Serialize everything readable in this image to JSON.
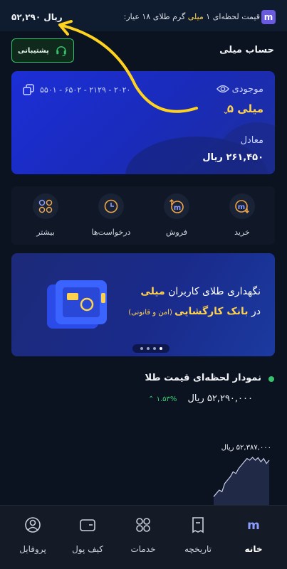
{
  "top_bar": {
    "price": "۵۲,۲۹۰ ریال",
    "ticker_before": "قیمت لحظه‌ای ۱ ",
    "ticker_highlight": "میلی",
    "ticker_after": " گرم طلای ۱۸ عیار:",
    "logo_letter": "m"
  },
  "account": {
    "title": "حساب میلی",
    "support_label": "پشتیبانی"
  },
  "balance_card": {
    "account_number": "۲۰۲۰ - ۲۱۲۹ - ۶۵۰۲ - ۵۵۰۱",
    "balance_label": "موجودی",
    "balance_value": "۵ میلی",
    "equivalent_label": "معادل",
    "equivalent_value": "۲۶۱,۴۵۰ ریال"
  },
  "actions": [
    {
      "label": "خرید",
      "icon": "buy-icon"
    },
    {
      "label": "فروش",
      "icon": "sell-icon"
    },
    {
      "label": "درخواست‌ها",
      "icon": "clock-icon"
    },
    {
      "label": "بیشتر",
      "icon": "grid-icon"
    }
  ],
  "banner": {
    "line1_before": "نگهداری طلای کاربران ",
    "line1_highlight": "میلی",
    "line2_before": "در ",
    "line2_highlight": "بانک کارگشایی",
    "line2_small": " (امن و قانونی)"
  },
  "chart_section": {
    "title": "نمودار لحظه‌ای قیمت طلا",
    "value": "۵۲,۲۹۰,۰۰۰ ریال",
    "change": "۱.۵۳%",
    "max_label": "۵۲,۳۸۷,۰۰۰ ریال"
  },
  "chart_data": {
    "type": "line",
    "title": "",
    "xlabel": "",
    "ylabel": "",
    "x": [
      0,
      1,
      2,
      3,
      4,
      5,
      6,
      7,
      8,
      9,
      10,
      11,
      12,
      13,
      14,
      15,
      16,
      17,
      18,
      19,
      20
    ],
    "series": [
      {
        "values": [
          52150000,
          52170000,
          52190000,
          52180000,
          52230000,
          52250000,
          52270000,
          52300000,
          52290000,
          52320000,
          52340000,
          52360000,
          52380000,
          52370000,
          52387000,
          52370000,
          52385000,
          52360000,
          52380000,
          52350000,
          52370000
        ]
      }
    ],
    "ylim": [
      52100000,
      52400000
    ]
  },
  "bottom_nav": [
    {
      "label": "خانه",
      "icon": "home-icon",
      "active": true
    },
    {
      "label": "تاریخچه",
      "icon": "receipt-icon",
      "active": false
    },
    {
      "label": "خدمات",
      "icon": "services-icon",
      "active": false
    },
    {
      "label": "کیف پول",
      "icon": "wallet-icon",
      "active": false
    },
    {
      "label": "پروفایل",
      "icon": "profile-icon",
      "active": false
    }
  ],
  "colors": {
    "accent_gold": "#ffd24d",
    "card_blue": "#1c2fd6",
    "positive_green": "#35c46c",
    "brand_purple": "#6a5ae0"
  }
}
